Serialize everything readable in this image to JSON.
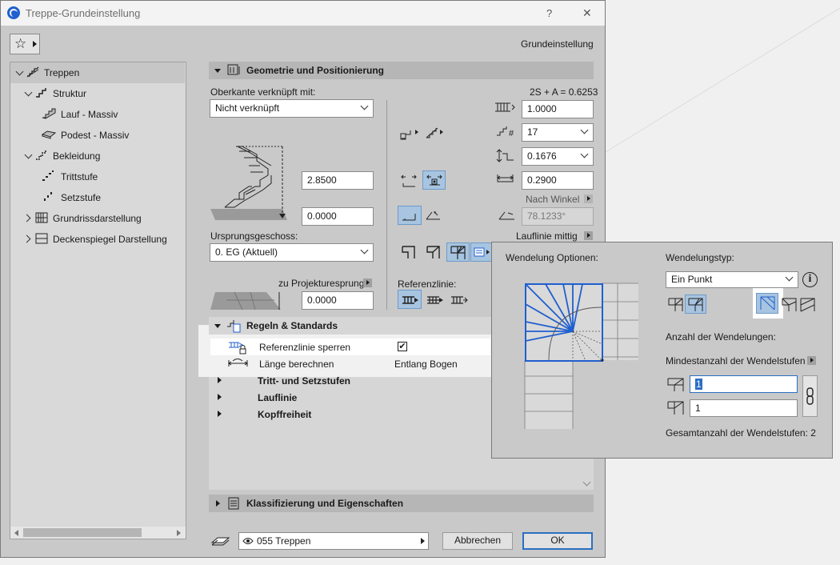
{
  "window": {
    "title": "Treppe-Grundeinstellung",
    "help": "?",
    "close": "✕",
    "header_right": "Grundeinstellung"
  },
  "tree": {
    "items": [
      {
        "label": "Treppen",
        "icon": "stairs-icon"
      },
      {
        "label": "Struktur",
        "icon": "structure-icon"
      },
      {
        "label": "Lauf - Massiv",
        "icon": "flight-icon"
      },
      {
        "label": "Podest - Massiv",
        "icon": "landing-icon"
      },
      {
        "label": "Bekleidung",
        "icon": "finish-icon"
      },
      {
        "label": "Trittstufe",
        "icon": "tread-icon"
      },
      {
        "label": "Setzstufe",
        "icon": "riser-icon"
      },
      {
        "label": "Grundrissdarstellung",
        "icon": "floorplan-icon"
      },
      {
        "label": "Deckenspiegel Darstellung",
        "icon": "ceiling-plan-icon"
      }
    ]
  },
  "geometry": {
    "section_title": "Geometrie und Positionierung",
    "top_link_label": "Oberkante verknüpft mit:",
    "top_link_value": "Nicht verknüpft",
    "formula": "2S + A = 0.6253",
    "height": "2.8500",
    "offset": "0.0000",
    "home_story_label": "Ursprungsgeschoss:",
    "home_story_value": "0. EG (Aktuell)",
    "project_zero_label": "zu Projekturesprung",
    "project_zero_value": "0.0000",
    "riser_count_total": "1.0000",
    "riser_number": "17",
    "riser_height": "0.1676",
    "tread_depth": "0.2900",
    "by_angle_label": "Nach Winkel",
    "angle_value": "78.1233°",
    "walking_line_label": "Lauflinie mittig",
    "reference_line_label": "Referenzlinie:"
  },
  "rules": {
    "section_title": "Regeln & Standards",
    "rows": [
      {
        "label": "Referenzlinie sperren",
        "value": "✔"
      },
      {
        "label": "Länge berechnen",
        "value": "Entlang Bogen"
      }
    ],
    "groups": [
      "Tritt- und Setzstufen",
      "Lauflinie",
      "Kopffreiheit"
    ]
  },
  "classification": {
    "section_title": "Klassifizierung und Eigenschaften"
  },
  "footer": {
    "layer": "055 Treppen",
    "cancel": "Abbrechen",
    "ok": "OK"
  },
  "popup": {
    "options_label": "Wendelung Optionen:",
    "type_label": "Wendelungstyp:",
    "type_value": "Ein Punkt",
    "count_label": "Anzahl der Wendelungen:",
    "min_label": "Mindestanzahl der Wendelstufen",
    "value_1": "1",
    "value_2": "1",
    "total_label": "Gesamtanzahl der Wendelstufen: 2"
  },
  "colors": {
    "accent": "#1f5fcf",
    "selected_bg": "#a7c4e0",
    "panel": "#c9c9c9"
  }
}
